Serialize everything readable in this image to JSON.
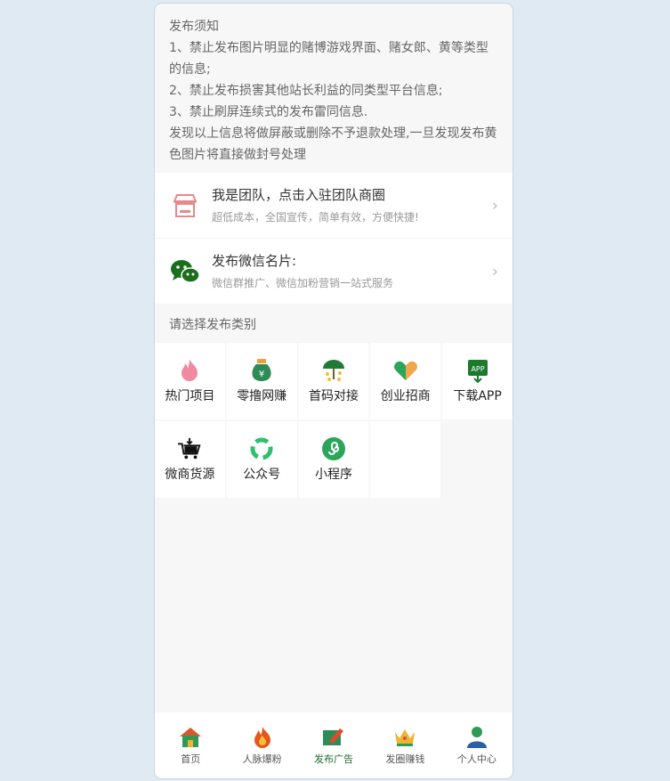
{
  "notice": {
    "title": "发布须知",
    "lines": [
      "1、禁止发布图片明显的赌博游戏界面、赌女郎、黄等类型的信息;",
      "2、禁止发布损害其他站长利益的同类型平台信息;",
      "3、禁止刷屏连续式的发布雷同信息.",
      "发现以上信息将做屏蔽或删除不予退款处理,一旦发现发布黄色图片将直接做封号处理"
    ]
  },
  "entries": [
    {
      "title": "我是团队，点击入驻团队商圈",
      "subtitle": "超低成本，全国宣传，简单有效，方便快捷!",
      "icon": "store-icon"
    },
    {
      "title": "发布微信名片:",
      "subtitle": "微信群推广、微信加粉营销一站式服务",
      "icon": "wechat-icon"
    }
  ],
  "category_title": "请选择发布类别",
  "categories": [
    {
      "label": "热门项目",
      "icon": "flame-icon"
    },
    {
      "label": "零撸网赚",
      "icon": "money-bag-icon"
    },
    {
      "label": "首码对接",
      "icon": "coin-tree-icon"
    },
    {
      "label": "创业招商",
      "icon": "handshake-heart-icon"
    },
    {
      "label": "下载APP",
      "icon": "app-download-icon"
    },
    {
      "label": "微商货源",
      "icon": "cart-icon"
    },
    {
      "label": "公众号",
      "icon": "recycle-icon"
    },
    {
      "label": "小程序",
      "icon": "mini-program-icon"
    }
  ],
  "tabs": [
    {
      "label": "首页",
      "icon": "home-icon",
      "active": false
    },
    {
      "label": "人脉爆粉",
      "icon": "fire-icon",
      "active": false
    },
    {
      "label": "发布广告",
      "icon": "publish-icon",
      "active": true
    },
    {
      "label": "发圈赚钱",
      "icon": "crown-icon",
      "active": false
    },
    {
      "label": "个人中心",
      "icon": "user-icon",
      "active": false
    }
  ]
}
